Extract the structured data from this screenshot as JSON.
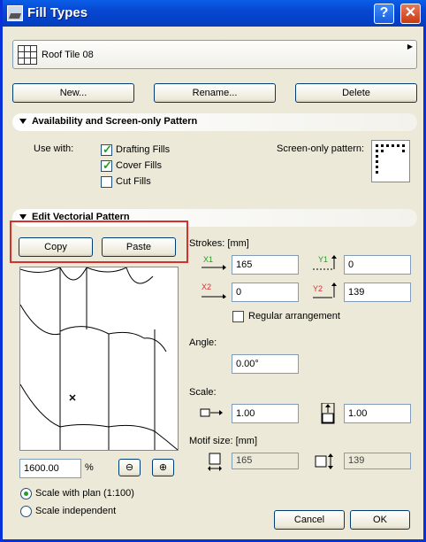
{
  "window": {
    "title": "Fill Types",
    "help_label": "?",
    "close_label": "✕"
  },
  "selector": {
    "icon": "tile-grid-icon",
    "value": "Roof Tile 08"
  },
  "actions": {
    "new": "New...",
    "rename": "Rename...",
    "delete": "Delete"
  },
  "availability": {
    "header": "Availability and Screen-only Pattern",
    "use_with_label": "Use with:",
    "options": [
      {
        "label": "Drafting Fills",
        "checked": true
      },
      {
        "label": "Cover Fills",
        "checked": true
      },
      {
        "label": "Cut Fills",
        "checked": false
      }
    ],
    "screen_only_label": "Screen-only pattern:"
  },
  "vectorial": {
    "header": "Edit Vectorial Pattern",
    "copy": "Copy",
    "paste": "Paste",
    "strokes_label": "Strokes: [mm]",
    "x1": {
      "label": "X1",
      "value": "165"
    },
    "y1": {
      "label": "Y1",
      "value": "0"
    },
    "x2": {
      "label": "X2",
      "value": "0"
    },
    "y2": {
      "label": "Y2",
      "value": "139"
    },
    "regular_arrangement": "Regular arrangement",
    "angle_label": "Angle:",
    "angle_value": "0.00°",
    "scale_label": "Scale:",
    "scale_x": "1.00",
    "scale_y": "1.00",
    "motif_label": "Motif size: [mm]",
    "motif_x": "165",
    "motif_y": "139",
    "zoom_value": "1600.00",
    "zoom_unit": "%",
    "scale_with_plan": "Scale with plan (1:100)",
    "scale_independent": "Scale independent"
  },
  "footer": {
    "cancel": "Cancel",
    "ok": "OK"
  },
  "colors": {
    "title_bar": "#0848d0",
    "highlight": "#d43030",
    "check": "#21a121"
  }
}
